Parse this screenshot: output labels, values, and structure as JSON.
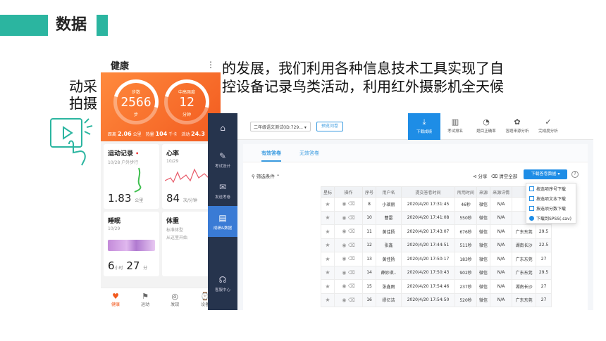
{
  "slide": {
    "title": "数据",
    "line1": "的发展，我们利用各种信息技术工具实现了自",
    "line2_left": "动采",
    "line2_right": "控设备记录鸟类活动，利用红外摄影机全天候",
    "line3_left": "拍摄"
  },
  "health": {
    "title": "健康",
    "more": "⋮",
    "steps_label": "步数",
    "steps": "2566",
    "steps_unit": "步",
    "active_label": "中高强度",
    "active": "12",
    "active_unit": "分钟",
    "stat1_label": "距离",
    "stat1": "2.06",
    "stat1_unit": "公里",
    "stat2_label": "热量",
    "stat2": "104",
    "stat2_unit": "千卡",
    "stat3_label": "活动",
    "stat3": "24.3",
    "stat3_unit": "",
    "cards": [
      {
        "title": "运动记录",
        "sub": "10/28 户外步行",
        "value": "1.83",
        "unit": "公里"
      },
      {
        "title": "心率",
        "sub": "10/29",
        "value": "84",
        "unit": "次/分钟"
      },
      {
        "title": "睡眠",
        "sub": "10/29",
        "value": "6",
        "unit": "小时",
        "value2": "27",
        "unit2": "分"
      },
      {
        "title": "体重",
        "sub": "标准体型",
        "sub2": "从这里开始",
        "value": "",
        "unit": ""
      }
    ],
    "tabs": [
      "健康",
      "运动",
      "发现",
      "设备"
    ]
  },
  "survey": {
    "select_value": "二年级语文测试(ID:729...",
    "preview_label": "预览问卷",
    "nav": [
      "下载成绩",
      "考试排名",
      "题目正确率",
      "答题来源分析",
      "完成度分析"
    ],
    "side": [
      "考试设计",
      "发送考卷",
      "成绩&数据",
      "客服中心"
    ],
    "subtabs": [
      "有效答卷",
      "无效答卷"
    ],
    "filter_label": "筛选条件",
    "share_label": "分享",
    "clear_label": "清空全部",
    "download_label": "下载答卷数据",
    "help": "?",
    "columns": [
      "星标",
      "操作",
      "序号",
      "用户名",
      "提交答卷时间",
      "所用时间",
      "来源",
      "来源详情",
      "",
      ""
    ],
    "rows": [
      [
        "8",
        "小琐丽",
        "2020/4/20 17:31:45",
        "46秒",
        "微信",
        "N/A",
        "",
        ""
      ],
      [
        "10",
        "曹雷",
        "2020/4/20 17:41:08",
        "550秒",
        "微信",
        "N/A",
        "",
        ""
      ],
      [
        "11",
        "黄佳扬",
        "2020/4/20 17:43:07",
        "676秒",
        "微信",
        "N/A",
        "广东东莞",
        "29.5"
      ],
      [
        "12",
        "张鑫",
        "2020/4/20 17:44:51",
        "511秒",
        "微信",
        "N/A",
        "湖南长沙",
        "22.5"
      ],
      [
        "13",
        "黄佳扬",
        "2020/4/20 17:50:17",
        "183秒",
        "微信",
        "N/A",
        "广东东莞",
        "27"
      ],
      [
        "14",
        "薛妙琪..",
        "2020/4/20 17:50:43",
        "902秒",
        "微信",
        "N/A",
        "广东东莞",
        "29.5"
      ],
      [
        "15",
        "张鑫雨",
        "2020/4/20 17:54:46",
        "237秒",
        "微信",
        "N/A",
        "湖南长沙",
        "27"
      ],
      [
        "16",
        "缪亿洁",
        "2020/4/20 17:54:50",
        "520秒",
        "微信",
        "N/A",
        "广东东莞",
        "27"
      ]
    ],
    "dropdown": [
      "按选项序号下载",
      "按选项文本下载",
      "按选项分数下载",
      "下载到SPSS(.sav)"
    ]
  }
}
